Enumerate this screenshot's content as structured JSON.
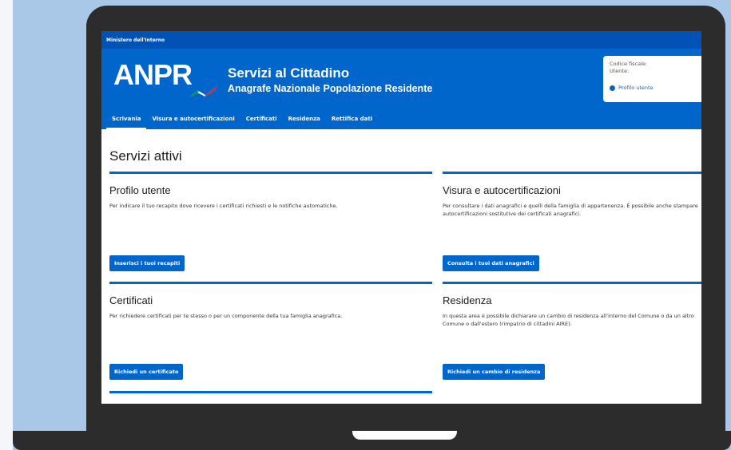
{
  "topbar": {
    "ministry": "Ministero dell'Interno"
  },
  "header": {
    "logo": "ANPR",
    "title": "Servizi al Cittadino",
    "subtitle": "Anagrafe Nazionale Popolazione Residente",
    "flag_colors": [
      "#009246",
      "#ffffff",
      "#ce2b37"
    ]
  },
  "user": {
    "codice_fiscale_label": "Codice fiscale:",
    "utente_label": "Utente:",
    "profile_link": "Profilo utente",
    "profile_icon": "user-circle-icon"
  },
  "nav": {
    "items": [
      {
        "label": "Scrivania",
        "active": true
      },
      {
        "label": "Visura e autocertificazioni",
        "active": false
      },
      {
        "label": "Certificati",
        "active": false
      },
      {
        "label": "Residenza",
        "active": false
      },
      {
        "label": "Rettifica dati",
        "active": false
      }
    ]
  },
  "main": {
    "title": "Servizi attivi",
    "cards": [
      {
        "title": "Profilo utente",
        "text": "Per indicare il tuo recapito dove ricevere i certificati richiesti e le notifiche automatiche.",
        "button": "Inserisci i tuoi recapiti"
      },
      {
        "title": "Visura e autocertificazioni",
        "text": "Per consultare i dati anagrafici e quelli della famiglia di appartenenza. È possibile anche stampare autocertificazioni sostitutive dei certificati anagrafici.",
        "button": "Consulta i tuoi dati anagrafici"
      },
      {
        "title": "Certificati",
        "text": "Per richiedere certificati per te stesso o per un componente della tua famiglia anagrafica.",
        "button": "Richiedi un certificato"
      },
      {
        "title": "Residenza",
        "text": "In questa area è possibile dichiarare un cambio di residenza all'interno del Comune o da un altro Comune o dall'estero (rimpatrio di cittadini AIRE).",
        "button": "Richiedi un cambio di residenza"
      }
    ]
  },
  "colors": {
    "primary": "#0066cc",
    "topbar": "#0052b4",
    "backdrop": "#a9c7e6",
    "laptop": "#2c2c2c"
  }
}
